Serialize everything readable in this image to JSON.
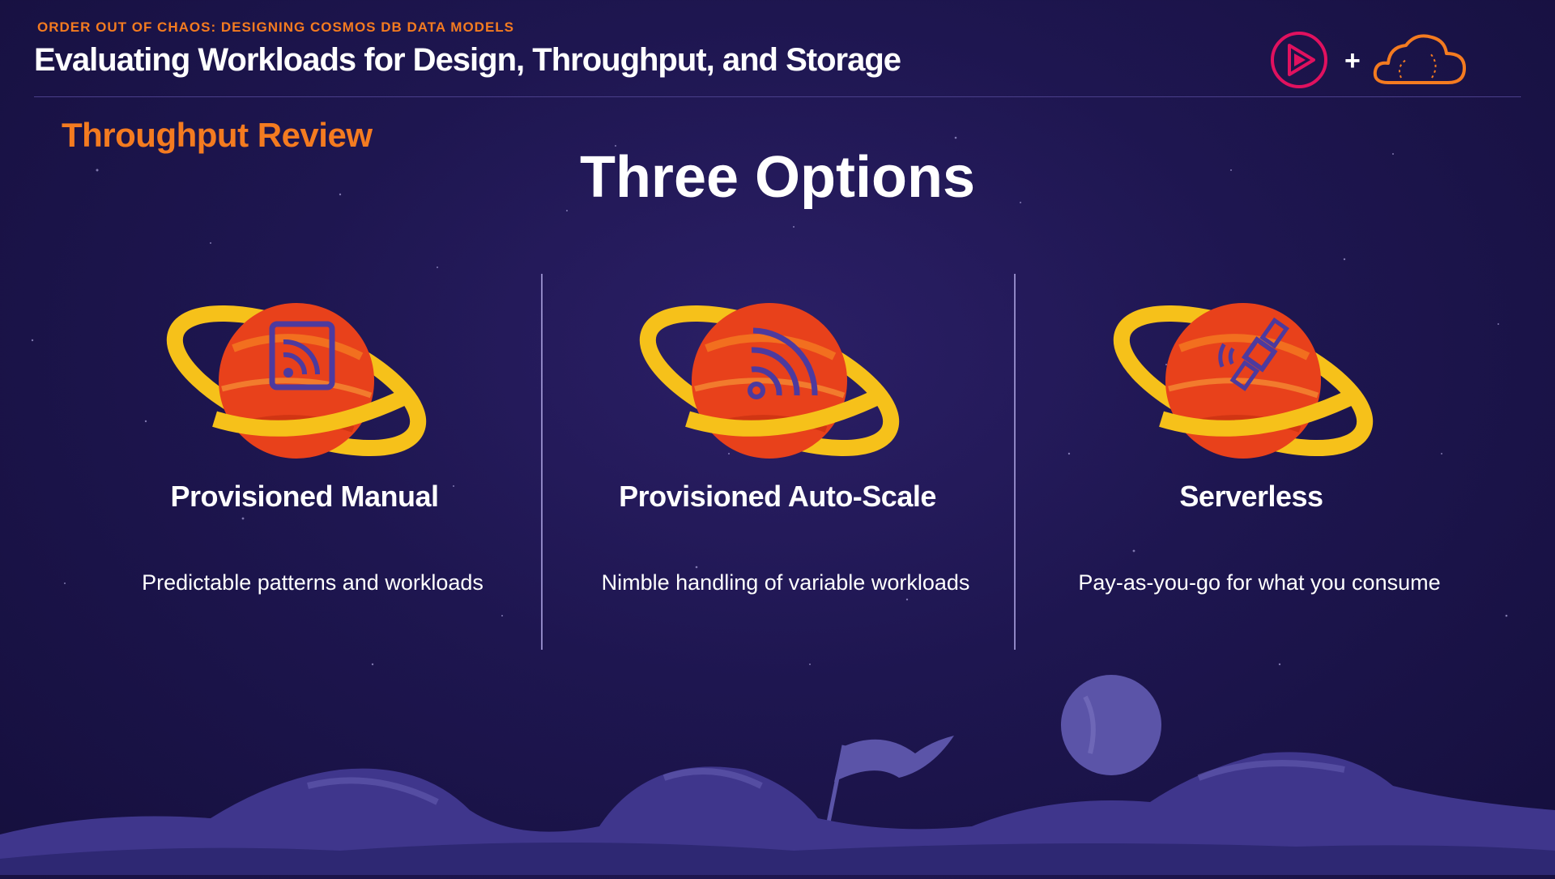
{
  "header": {
    "course": "ORDER OUT OF CHAOS: DESIGNING COSMOS DB DATA MODELS",
    "title": "Evaluating Workloads for Design, Throughput, and Storage",
    "plus": "+"
  },
  "slide": {
    "section": "Throughput Review",
    "heading": "Three Options"
  },
  "options": [
    {
      "title": "Provisioned Manual",
      "description": "Predictable patterns and workloads",
      "icon": "rss-feed-icon"
    },
    {
      "title": "Provisioned Auto-Scale",
      "description": "Nimble handling of variable workloads",
      "icon": "wifi-signal-icon"
    },
    {
      "title": "Serverless",
      "description": "Pay-as-you-go for what you consume",
      "icon": "satellite-icon"
    }
  ],
  "colors": {
    "accent": "#f47b20",
    "background": "#1e1650",
    "planet_red": "#e8411b",
    "ring_yellow": "#f6c11a",
    "icon_purple": "#4d3a9e",
    "pluralsight_pink": "#e0115f"
  },
  "logos": [
    "pluralsight-logo",
    "cloud-logo"
  ]
}
